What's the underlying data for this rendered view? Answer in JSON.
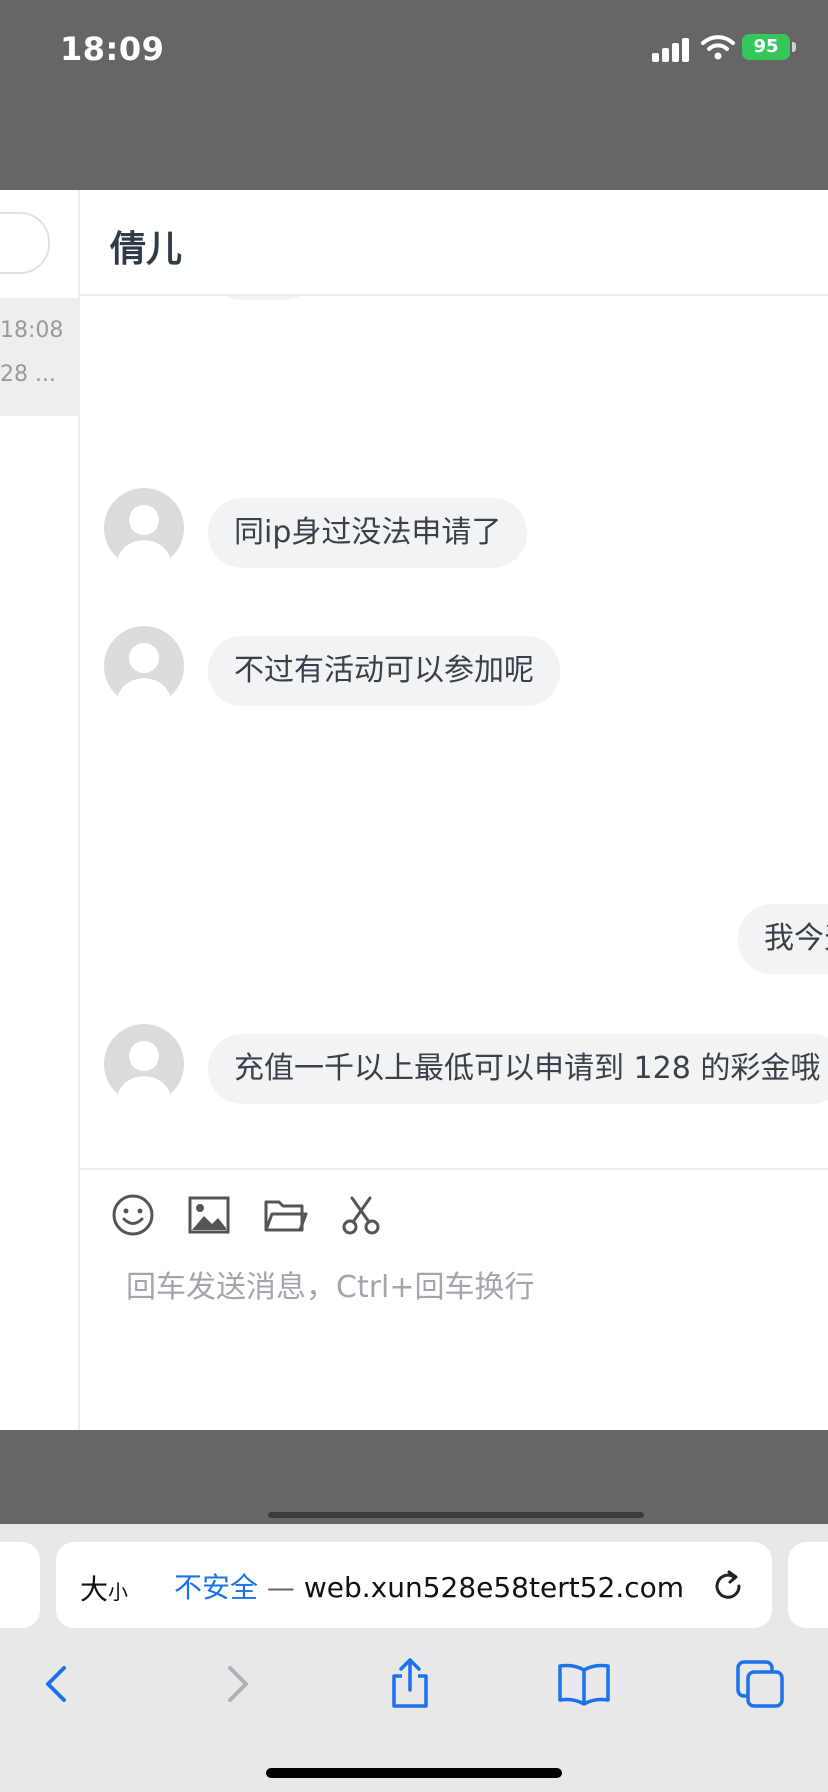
{
  "status_bar": {
    "time": "18:09",
    "battery": "95"
  },
  "sidebar": {
    "time": "18:08",
    "preview": "28 ..."
  },
  "chat": {
    "title": "倩儿",
    "messages": [
      {
        "side": "left",
        "text": "同ip身过没法申请了"
      },
      {
        "side": "left",
        "text": "不过有活动可以参加呢"
      },
      {
        "side": "right",
        "text": "我今天"
      },
      {
        "side": "left",
        "text": "充值一千以上最低可以申请到 128 的彩金哦"
      }
    ],
    "input_placeholder": "回车发送消息，Ctrl+回车换行"
  },
  "safari": {
    "aa_big": "大",
    "aa_small": "小",
    "not_secure": "不安全",
    "separator": " — ",
    "url": "web.xun528e58tert52.com"
  },
  "icons": [
    "emoji-icon",
    "image-icon",
    "folder-icon",
    "scissors-icon",
    "back-icon",
    "forward-icon",
    "share-icon",
    "bookmarks-icon",
    "tabs-icon",
    "reload-icon"
  ]
}
